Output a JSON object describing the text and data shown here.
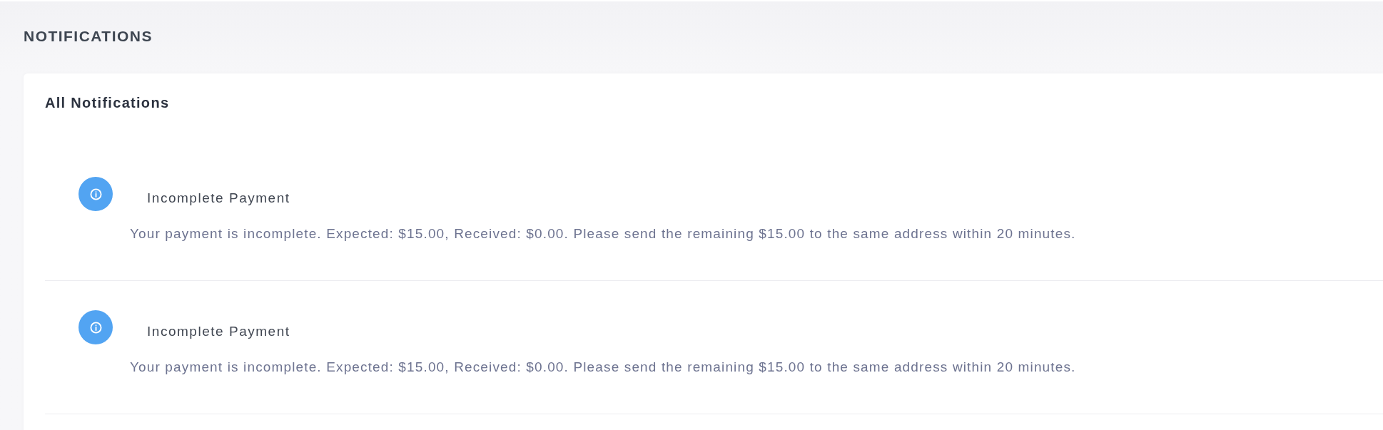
{
  "page": {
    "title": "NOTIFICATIONS"
  },
  "card": {
    "title": "All Notifications",
    "notifications": [
      {
        "title": "Incomplete Payment",
        "message": "Your payment is incomplete. Expected: $15.00, Received: $0.00. Please send the remaining $15.00 to the same address within 20 minutes."
      },
      {
        "title": "Incomplete Payment",
        "message": "Your payment is incomplete. Expected: $15.00, Received: $0.00. Please send the remaining $15.00 to the same address within 20 minutes."
      }
    ]
  }
}
